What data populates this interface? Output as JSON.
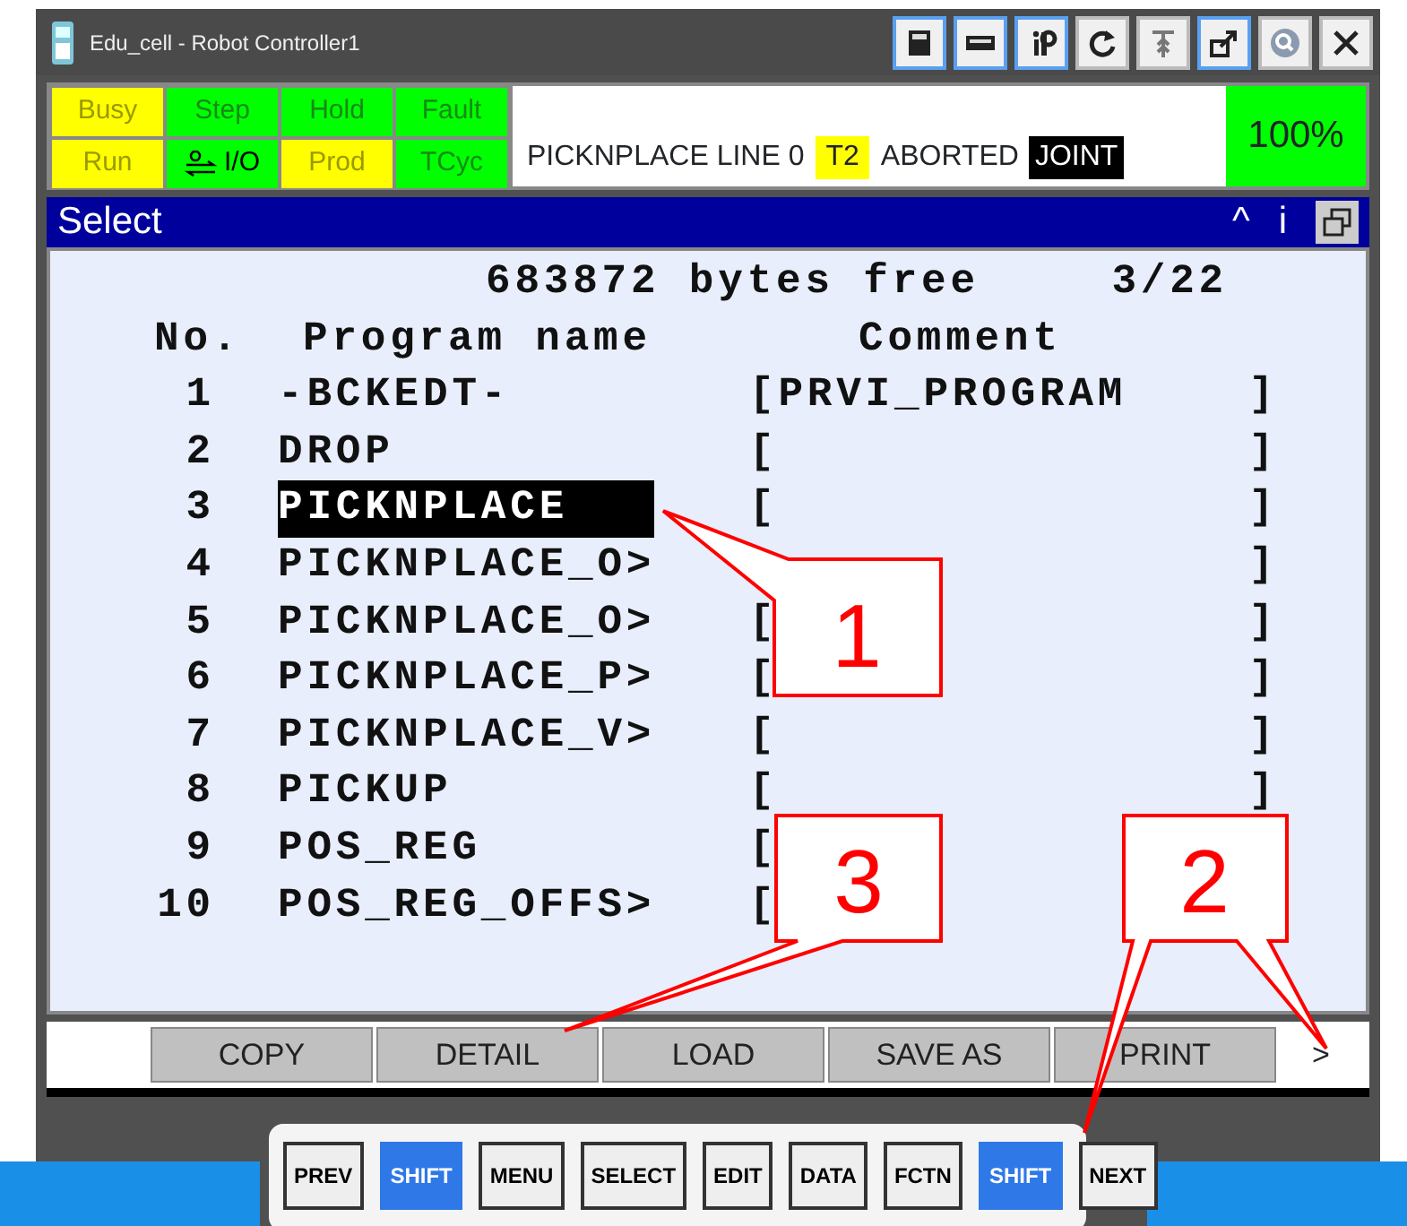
{
  "window": {
    "title": "Edu_cell - Robot Controller1"
  },
  "status_cells": [
    {
      "label": "Busy",
      "on": true,
      "kind": "plain"
    },
    {
      "label": "Step",
      "on": false,
      "kind": "plain"
    },
    {
      "label": "Hold",
      "on": false,
      "kind": "plain"
    },
    {
      "label": "Fault",
      "on": false,
      "kind": "plain"
    },
    {
      "label": "Run",
      "on": true,
      "kind": "plain"
    },
    {
      "label": "I/O",
      "on": false,
      "kind": "io"
    },
    {
      "label": "Prod",
      "on": true,
      "kind": "plain"
    },
    {
      "label": "TCyc",
      "on": false,
      "kind": "plain"
    }
  ],
  "message": [
    {
      "text": "PICKNPLACE LINE 0",
      "kind": "plain"
    },
    {
      "text": "T2",
      "kind": "highlight"
    },
    {
      "text": "ABORTED",
      "kind": "plain"
    },
    {
      "text": "JOINT",
      "kind": "inverse"
    }
  ],
  "override": "100%",
  "screen": {
    "title": "Select",
    "controls": [
      "^",
      "i"
    ],
    "memory": "683872 bytes free",
    "position": "3/22",
    "columns": [
      "No.",
      "Program name",
      "Comment"
    ],
    "rows": [
      {
        "no": "1",
        "name": "-BCKEDT-",
        "open": "[",
        "comment": "PRVI_PROGRAM",
        "close": "]",
        "selected": false
      },
      {
        "no": "2",
        "name": "DROP",
        "open": "[",
        "close": "]",
        "selected": false
      },
      {
        "no": "3",
        "name": "PICKNPLACE",
        "open": "[",
        "close": "]",
        "selected": true
      },
      {
        "no": "4",
        "name": "PICKNPLACE_O>",
        "close": "]",
        "selected": false
      },
      {
        "no": "5",
        "name": "PICKNPLACE_O>",
        "open": "[",
        "close": "]",
        "selected": false
      },
      {
        "no": "6",
        "name": "PICKNPLACE_P>",
        "open": "[",
        "close": "]",
        "selected": false
      },
      {
        "no": "7",
        "name": "PICKNPLACE_V>",
        "open": "[",
        "close": "]",
        "selected": false
      },
      {
        "no": "8",
        "name": "PICKUP",
        "open": "[",
        "close": "]",
        "selected": false
      },
      {
        "no": "9",
        "name": "POS_REG",
        "open": "[",
        "selected": false
      },
      {
        "no": "10",
        "name": "POS_REG_OFFS>",
        "open": "[",
        "selected": false
      }
    ]
  },
  "function_keys": [
    "COPY",
    "DETAIL",
    "LOAD",
    "SAVE AS",
    "PRINT"
  ],
  "more": ">",
  "keys": [
    {
      "label": "PREV",
      "shift": false
    },
    {
      "label": "SHIFT",
      "shift": true
    },
    {
      "label": "MENU",
      "shift": false
    },
    {
      "label": "SELECT",
      "shift": false
    },
    {
      "label": "EDIT",
      "shift": false
    },
    {
      "label": "DATA",
      "shift": false
    },
    {
      "label": "FCTN",
      "shift": false
    },
    {
      "label": "SHIFT",
      "shift": true
    },
    {
      "label": "NEXT",
      "shift": false
    }
  ],
  "callouts": [
    "1",
    "3",
    "2"
  ]
}
